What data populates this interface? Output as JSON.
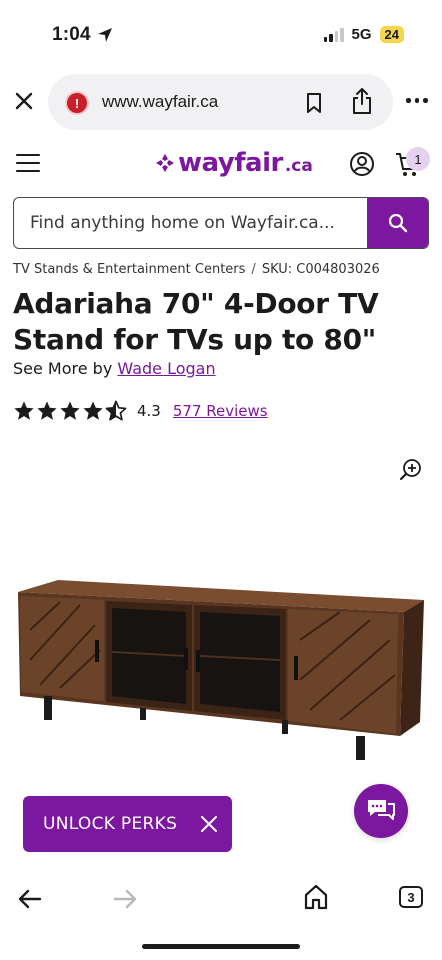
{
  "status_bar": {
    "time": "1:04",
    "network": "5G",
    "battery": "24",
    "icons": [
      "location-arrow-icon",
      "signal-icon"
    ]
  },
  "browser": {
    "url": "www.wayfair.ca",
    "icons": [
      "close-icon",
      "site-alert-icon",
      "bookmark-icon",
      "share-icon",
      "more-icon"
    ]
  },
  "header": {
    "logo_text": "wayfair",
    "logo_tld": ".ca",
    "cart_count": "1",
    "brand_color": "#7b189f",
    "icons": [
      "menu-icon",
      "account-icon",
      "cart-icon"
    ]
  },
  "search": {
    "placeholder": "Find anything home on Wayfair.ca...",
    "icon": "search-icon"
  },
  "product": {
    "breadcrumb_category": "TV Stands & Entertainment Centers",
    "breadcrumb_separator": "/",
    "sku": "SKU: C004803026",
    "title": "Adariaha 70\" 4-Door TV Stand for TVs up to 80\"",
    "see_more_prefix": "See More by",
    "brand": "Wade Logan",
    "rating": "4.3",
    "rating_stars": 4.3,
    "reviews": "577 Reviews",
    "image_icon": "zoom-in-icon"
  },
  "promo": {
    "perks_label": "UNLOCK PERKS",
    "icons": [
      "close-icon",
      "chat-icon"
    ]
  },
  "bottom_nav": {
    "tab_count": "3",
    "icons": [
      "back-arrow-icon",
      "forward-arrow-icon",
      "home-icon",
      "tabs-icon"
    ]
  }
}
